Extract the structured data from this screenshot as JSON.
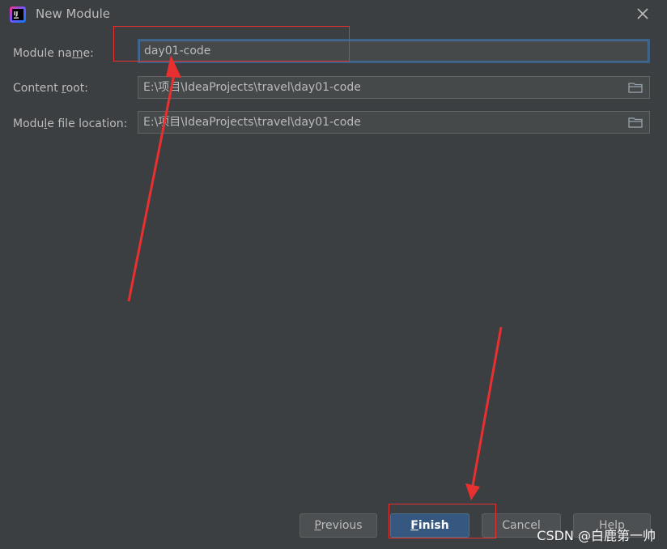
{
  "window": {
    "title": "New Module"
  },
  "form": {
    "module_name": {
      "label_pre": "Module na",
      "label_u": "m",
      "label_post": "e:",
      "value": "day01-code"
    },
    "content_root": {
      "label_pre": "Content ",
      "label_u": "r",
      "label_post": "oot:",
      "value": "E:\\项目\\IdeaProjects\\travel\\day01-code"
    },
    "module_file_location": {
      "label_pre": "Modu",
      "label_u": "l",
      "label_post": "e file location:",
      "value": "E:\\项目\\IdeaProjects\\travel\\day01-code"
    }
  },
  "buttons": {
    "previous": {
      "u": "P",
      "rest": "revious"
    },
    "finish": {
      "u": "F",
      "rest": "inish"
    },
    "cancel": "Cancel",
    "help": "Help"
  },
  "watermark": "CSDN @白鹿第一帅",
  "colors": {
    "background": "#3c3f41",
    "focus_border": "#3d6185",
    "annotation": "#e83030",
    "primary_button": "#365880"
  },
  "icons": [
    "intellij-app-icon",
    "close-icon",
    "folder-icon"
  ]
}
